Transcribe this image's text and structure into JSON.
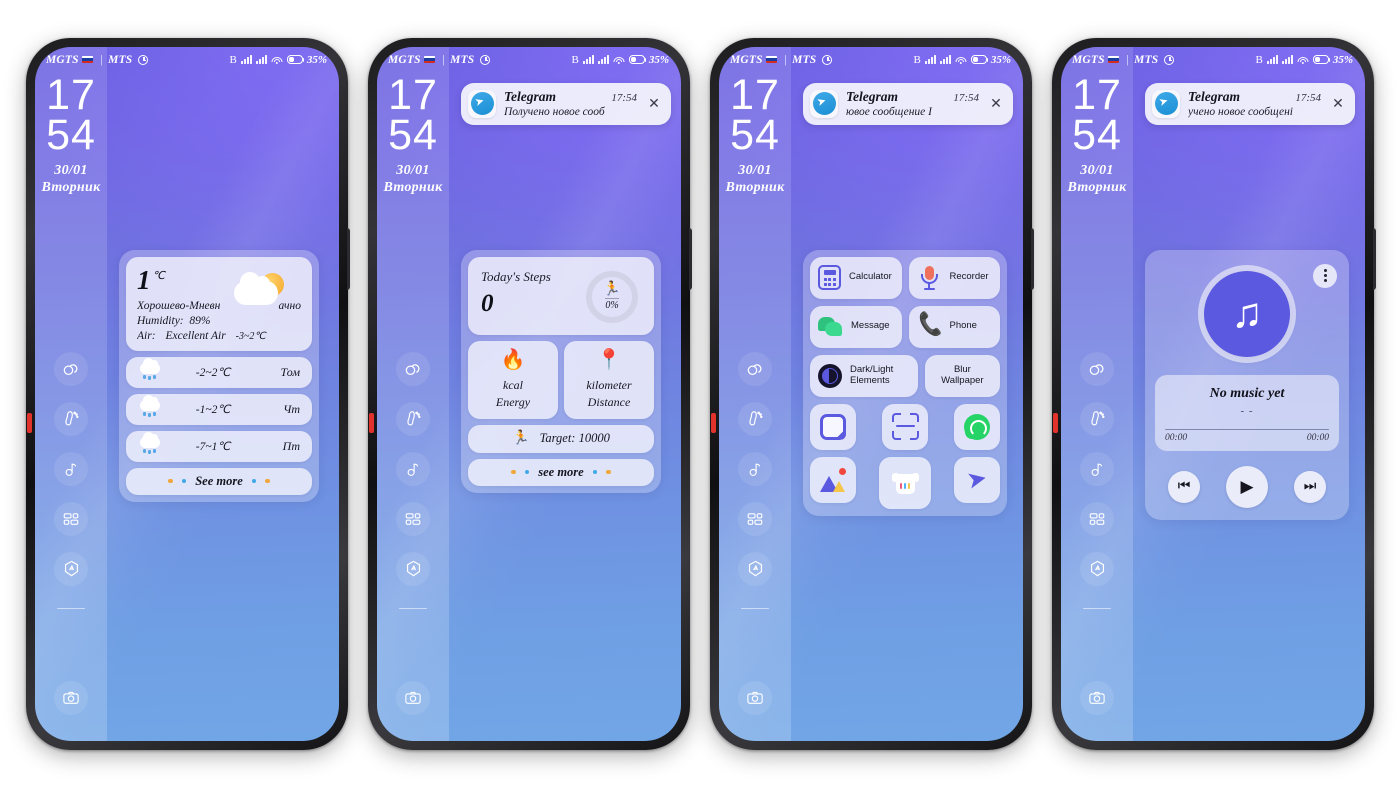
{
  "status_bar": {
    "carrier_primary": "MGTS",
    "separator": "|",
    "carrier_secondary": "MTS",
    "bluetooth": "B",
    "battery_percent": "35%"
  },
  "lock_clock": {
    "hours": "17",
    "minutes": "54",
    "date": "30/01",
    "weekday": "Вторник"
  },
  "sidebar": {
    "items": [
      {
        "name": "weather",
        "icon": "cloud-icon"
      },
      {
        "name": "steps",
        "icon": "footprint-icon"
      },
      {
        "name": "music",
        "icon": "music-note-icon"
      },
      {
        "name": "apps",
        "icon": "apps-grid-icon"
      },
      {
        "name": "compass",
        "icon": "compass-icon"
      }
    ],
    "camera": {
      "name": "camera",
      "icon": "camera-icon"
    }
  },
  "notification": {
    "app": "Telegram",
    "time": "17:54",
    "close_label": "✕",
    "texts": [
      "Получено новое сооб",
      "ювое сообщение      I",
      "учено новое сообщені"
    ]
  },
  "phones": [
    {
      "id": "phone-weather",
      "widget": "weather",
      "has_notification": false
    },
    {
      "id": "phone-steps",
      "widget": "steps",
      "has_notification": true,
      "notification_index": 0
    },
    {
      "id": "phone-apps",
      "widget": "apps",
      "has_notification": true,
      "notification_index": 1
    },
    {
      "id": "phone-music",
      "widget": "music",
      "has_notification": true,
      "notification_index": 2
    }
  ],
  "weather_widget": {
    "temperature": "1",
    "unit": "℃",
    "location": "Хорошево-Мневн",
    "condition": "ачно",
    "humidity_label": "Humidity:",
    "humidity_value": "89%",
    "air_label": "Air:",
    "air_value": "Excellent Air",
    "today_range": "-3~2℃",
    "forecast": [
      {
        "range": "-2~2℃",
        "day": "Том"
      },
      {
        "range": "-1~2℃",
        "day": "Чт"
      },
      {
        "range": "-7~1℃",
        "day": "Пт"
      }
    ],
    "see_more": "See more"
  },
  "steps_widget": {
    "title": "Today's Steps",
    "count": "0",
    "percent": "0%",
    "tiles": [
      {
        "unit": "kcal",
        "label": "Energy",
        "icon": "flame-icon"
      },
      {
        "unit": "kilometer",
        "label": "Distance",
        "icon": "route-pin-icon"
      }
    ],
    "target": "Target: 10000",
    "see_more": "see more"
  },
  "apps_widget": {
    "labeled": [
      {
        "label": "Calculator",
        "icon": "calculator-icon"
      },
      {
        "label": "Recorder",
        "icon": "microphone-icon"
      },
      {
        "label": "Message",
        "icon": "message-bubbles-icon"
      },
      {
        "label": "Phone",
        "icon": "phone-handset-icon"
      },
      {
        "label": "Dark/Light Elements",
        "icon": "dark-light-icon"
      },
      {
        "label": "Blur Wallpaper",
        "icon": ""
      }
    ],
    "icons": [
      {
        "name": "notes-icon"
      },
      {
        "name": "scanner-icon"
      },
      {
        "name": "whatsapp-icon"
      },
      {
        "name": "gallery-icon"
      },
      {
        "name": "clothes-icon"
      },
      {
        "name": "telegram-icon"
      }
    ]
  },
  "music_widget": {
    "title": "No music yet",
    "subtitle": "- -",
    "time_elapsed": "00:00",
    "time_total": "00:00",
    "controls": {
      "previous": "⏮",
      "play": "▶",
      "next": "⏭"
    },
    "more_menu": "more-options-icon",
    "album_icon": "music-note-icon"
  },
  "colors": {
    "accent_purple": "#5a59e0",
    "wallpaper_top": "#6a5fe0",
    "wallpaper_bottom": "#71a6e6",
    "card": "#f3f3fc",
    "telegram_blue": "#1a8fd4",
    "whatsapp_green": "#25d366",
    "battery_red": "#e2322c"
  }
}
